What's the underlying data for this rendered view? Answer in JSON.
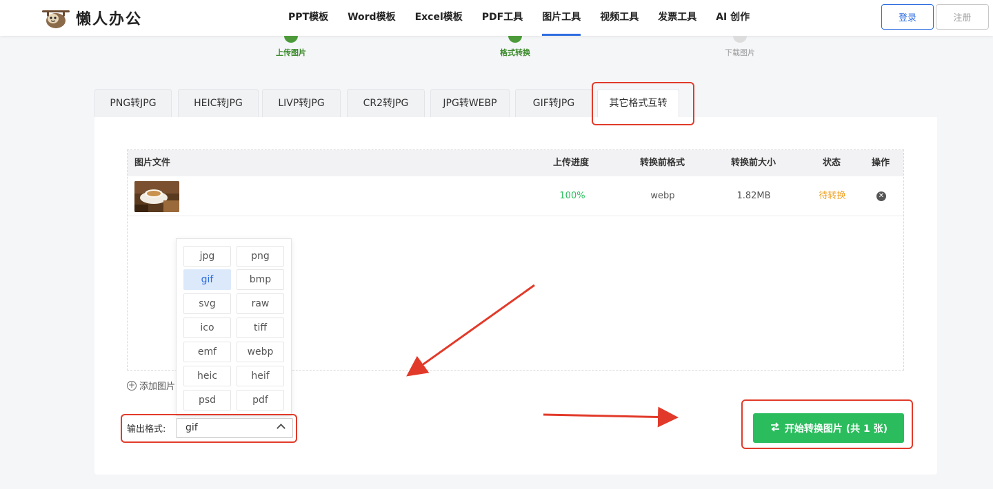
{
  "header": {
    "logo_text": "懒人办公",
    "nav": [
      "PPT模板",
      "Word模板",
      "Excel模板",
      "PDF工具",
      "图片工具",
      "视频工具",
      "发票工具",
      "AI 创作"
    ],
    "active_nav_index": 4,
    "login_label": "登录",
    "register_label": "注册"
  },
  "steps": [
    {
      "label": "上传图片",
      "state": "done"
    },
    {
      "label": "格式转换",
      "state": "done"
    },
    {
      "label": "下载图片",
      "state": "todo"
    }
  ],
  "tabs": [
    "PNG转JPG",
    "HEIC转JPG",
    "LIVP转JPG",
    "CR2转JPG",
    "JPG转WEBP",
    "GIF转JPG",
    "其它格式互转"
  ],
  "active_tab_index": 6,
  "table": {
    "headers": {
      "file": "图片文件",
      "progress": "上传进度",
      "format": "转换前格式",
      "size": "转换前大小",
      "status": "状态",
      "action": "操作"
    },
    "rows": [
      {
        "progress": "100%",
        "format": "webp",
        "size": "1.82MB",
        "status": "待转换"
      }
    ]
  },
  "add_image_label": "添加图片",
  "format_options": [
    "jpg",
    "png",
    "gif",
    "bmp",
    "svg",
    "raw",
    "ico",
    "tiff",
    "emf",
    "webp",
    "heic",
    "heif",
    "psd",
    "pdf"
  ],
  "selected_format": "gif",
  "output_format_label": "输出格式:",
  "start_button_label": "开始转换图片 (共 1 张)",
  "colors": {
    "accent": "#2d6ce0",
    "success": "#2bbd5d",
    "pending": "#f0a020",
    "annotation": "#e23a2a"
  }
}
